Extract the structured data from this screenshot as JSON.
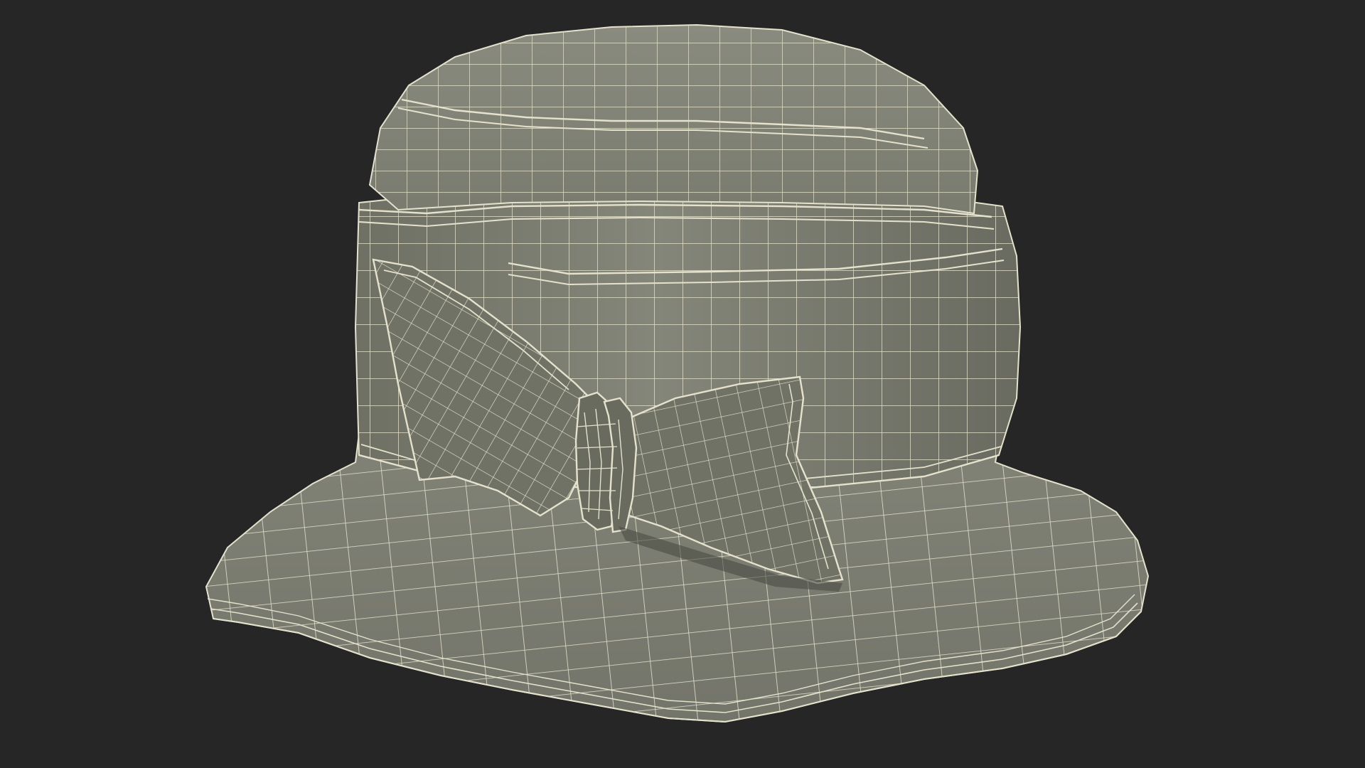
{
  "scene": {
    "background_color": "#262626",
    "surface_color": "#7c7d70",
    "surface_shadow_color": "#5f6055",
    "wire_color": "#e4e2cc",
    "object": "bucket-hat-wireframe"
  }
}
